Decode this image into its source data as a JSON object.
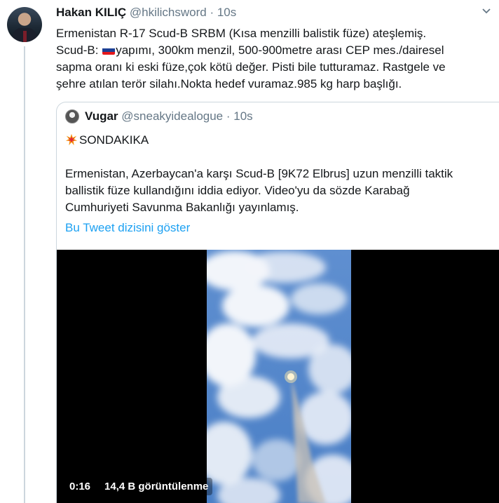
{
  "tweet": {
    "author_name": "Hakan KILIÇ",
    "handle": "@hkilichsword",
    "time": "· 10s",
    "line1": "Ermenistan R-17 Scud-B SRBM (Kısa menzilli balistik füze) ateşlemiş.",
    "line2_prefix": "Scud-B: ",
    "line2_suffix": "yapımı, 300km menzil, 500-900metre arası CEP mes./dairesel",
    "line3": "sapma oranı ki eski füze,çok kötü değer. Pisti bile tutturamaz. Rastgele ve",
    "line4": "şehre atılan terör silahı.Nokta hedef vuramaz.985 kg harp başlığı.",
    "flag_colors": [
      "#ffffff",
      "#1c3f94",
      "#e4181c"
    ]
  },
  "quote": {
    "author_name": "Vugar",
    "handle": "@sneakyidealogue",
    "time": "· 10s",
    "headline": "SONDAKIKA",
    "body_line1": "Ermenistan, Azerbaycan'a karşı Scud-B [9K72 Elbrus] uzun menzilli taktik",
    "body_line2": "ballistik füze kullandığını iddia ediyor. Video'yu da sözde Karabağ",
    "body_line3": "Cumhuriyeti Savunma Bakanlığı yayınlamış.",
    "show_thread": "Bu Tweet dizisini göster"
  },
  "video": {
    "timestamp": "0:16",
    "views": "14,4 B görüntülenme"
  },
  "colors": {
    "accent": "#1da1f2",
    "muted": "#657786",
    "border": "#ccd6dd"
  }
}
